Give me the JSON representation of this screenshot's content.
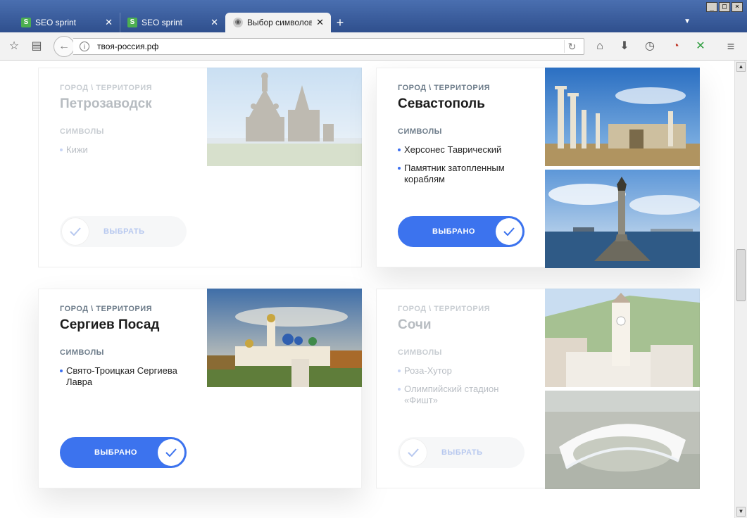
{
  "browser": {
    "tabs": [
      {
        "label": "SEO sprint",
        "favicon": "S"
      },
      {
        "label": "SEO sprint",
        "favicon": "S"
      },
      {
        "label": "Выбор символов..."
      }
    ],
    "url": "твоя-россия.рф"
  },
  "labels": {
    "kicker": "ГОРОД \\ ТЕРРИТОРИЯ",
    "symbols": "СИМВОЛЫ",
    "selected": "ВЫБРАНО",
    "select": "ВЫБРАТЬ"
  },
  "cards": [
    {
      "city": "Петрозаводск",
      "symbols": [
        "Кижи"
      ],
      "state": "unselected"
    },
    {
      "city": "Севастополь",
      "symbols": [
        "Херсонес Таврический",
        "Памятник затопленным кораблям"
      ],
      "state": "selected"
    },
    {
      "city": "Сергиев Посад",
      "symbols": [
        "Свято-Троицкая Сергиева Лавра"
      ],
      "state": "selected"
    },
    {
      "city": "Сочи",
      "symbols": [
        "Роза-Хутор",
        "Олимпийский стадион «Фишт»"
      ],
      "state": "unselected"
    }
  ],
  "colors": {
    "accent": "#3c73ee",
    "titlebar": "#3a5c9c"
  }
}
